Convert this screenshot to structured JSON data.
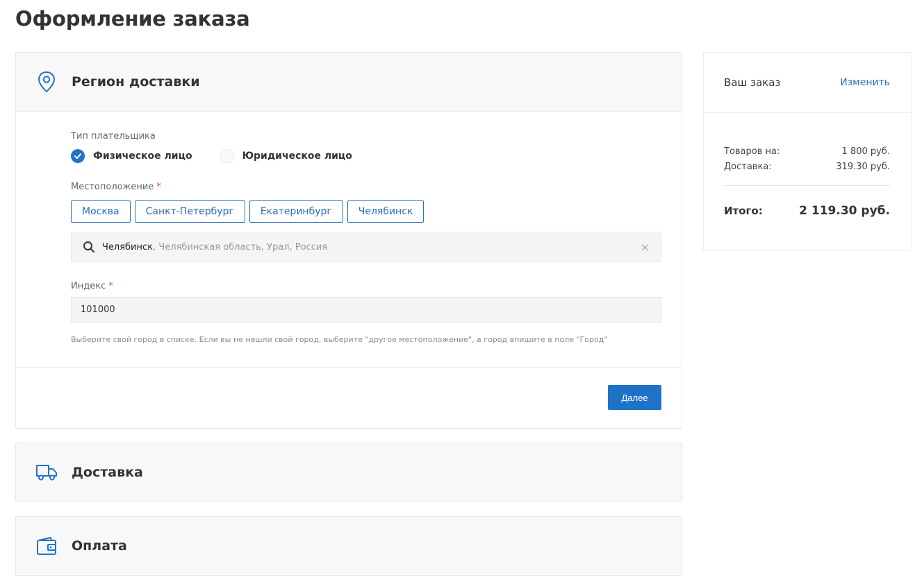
{
  "page": {
    "title": "Оформление заказа"
  },
  "colors": {
    "accent": "#1f73c7",
    "link": "#2e6eb3",
    "required": "#d9534f"
  },
  "region": {
    "title": "Регион доставки",
    "icon": "map-pin-icon",
    "payer_label": "Тип плательщика",
    "payer_options": [
      {
        "label": "Физическое лицо",
        "checked": true
      },
      {
        "label": "Юридическое лицо",
        "checked": false
      }
    ],
    "location_label": "Местоположение",
    "required_mark": "*",
    "cities": [
      "Москва",
      "Санкт-Петербург",
      "Екатеринбург",
      "Челябинск"
    ],
    "search": {
      "city": "Челябинск",
      "rest": ", Челябинская область, Урал, Россия",
      "clear": "×"
    },
    "index_label": "Индекс",
    "index_value": "101000",
    "hint": "Выберите свой город в списке. Если вы не нашли свой город, выберите \"другое местоположение\", а город впишите в поле \"Город\"",
    "next_button": "Далее"
  },
  "delivery": {
    "title": "Доставка",
    "icon": "truck-icon"
  },
  "payment": {
    "title": "Оплата",
    "icon": "wallet-icon"
  },
  "summary": {
    "title": "Ваш заказ",
    "edit": "Изменить",
    "goods_label": "Товаров на:",
    "goods_value": "1 800 руб.",
    "delivery_label": "Доставка:",
    "delivery_value": "319.30 руб.",
    "total_label": "Итого:",
    "total_value": "2 119.30 руб."
  }
}
